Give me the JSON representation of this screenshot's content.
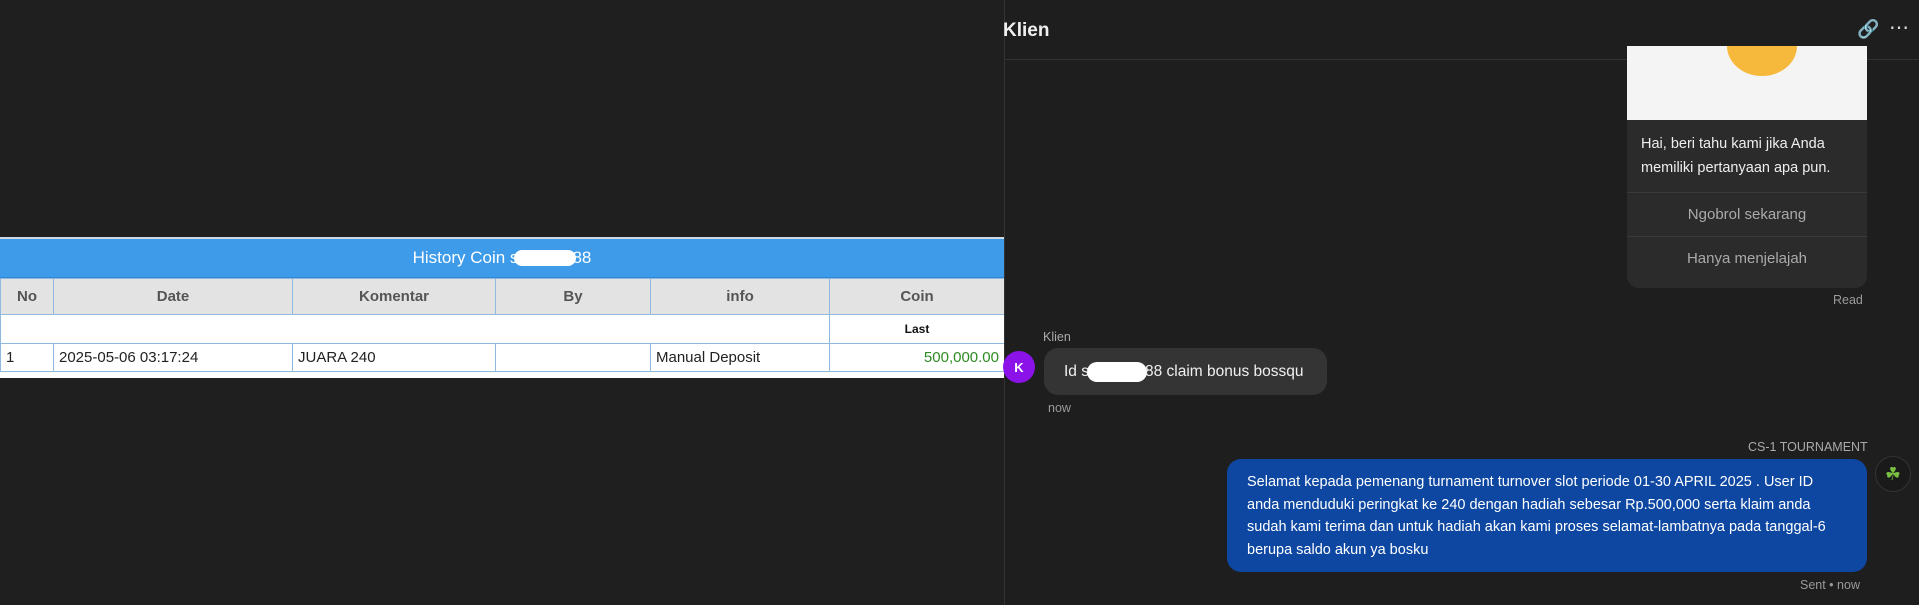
{
  "coin_history": {
    "title_prefix": "History Coin s",
    "title_suffix": "88",
    "columns": [
      "No",
      "Date",
      "Komentar",
      "By",
      "info",
      "Coin"
    ],
    "last_label": "Last",
    "rows": [
      {
        "no": "1",
        "date": "2025-05-06 03:17:24",
        "komentar": "JUARA 240",
        "by": "",
        "info": "Manual Deposit",
        "coin": "500,000.00"
      }
    ]
  },
  "chat": {
    "header_title": "Klien",
    "bot_message": "Hai, beri tahu kami jika Anda memiliki pertanyaan apa pun.",
    "bot_buttons": [
      "Ngobrol sekarang",
      "Hanya menjelajah"
    ],
    "read_status": "Read",
    "client_name": "Klien",
    "client_avatar_letter": "K",
    "client_msg_prefix": "Id s",
    "client_msg_suffix": "88 claim bonus bossqu",
    "client_time": "now",
    "agent_name": "CS-1 TOURNAMENT",
    "agent_message": "Selamat kepada pemenang turnament turnover slot periode 01-30 APRIL 2025 . User ID anda menduduki peringkat ke 240 dengan hadiah sebesar Rp.500,000 serta klaim anda sudah kami terima dan untuk hadiah akan kami proses selamat-lambatnya pada tanggal-6 berupa saldo akun ya bosku",
    "sent_status": "Sent • now"
  }
}
